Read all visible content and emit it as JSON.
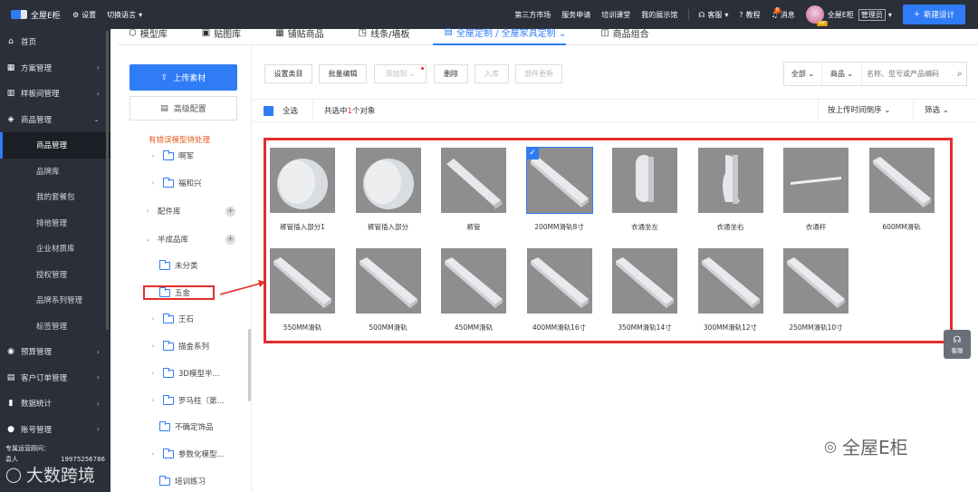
{
  "topbar": {
    "brand": "全屋E柜",
    "settings": "设置",
    "language": "切换语言",
    "links": [
      "第三方市场",
      "服务申请",
      "培训课堂",
      "我的展示馆"
    ],
    "service": "客服",
    "tutorial": "教程",
    "message": "消息",
    "message_count": "8",
    "vip": "VIP",
    "user": "全屋E柜",
    "role": "管理员",
    "new_design": "新建设计"
  },
  "nav": {
    "items": [
      {
        "label": "首页",
        "icon": "home-icon",
        "glyph": "⌂"
      },
      {
        "label": "方案管理",
        "icon": "grid-icon",
        "glyph": "▦",
        "arrow": "›"
      },
      {
        "label": "样板间管理",
        "icon": "room-icon",
        "glyph": "▥",
        "arrow": "›"
      },
      {
        "label": "商品管理",
        "icon": "box-icon",
        "glyph": "◈",
        "arrow": "⌄"
      }
    ],
    "subs": [
      "商品管理",
      "品牌库",
      "我的套餐包",
      "排他管理",
      "企业材质库",
      "授权管理",
      "品牌系列管理",
      "标签管理"
    ],
    "items2": [
      {
        "label": "预算管理",
        "icon": "budget-icon",
        "glyph": "◉",
        "arrow": "›"
      },
      {
        "label": "客户订单管理",
        "icon": "order-icon",
        "glyph": "▤",
        "arrow": "›"
      },
      {
        "label": "数据统计",
        "icon": "chart-icon",
        "glyph": "▮",
        "arrow": "›"
      },
      {
        "label": "账号管理",
        "icon": "account-icon",
        "glyph": "●",
        "arrow": "›"
      }
    ],
    "footer_title": "专属运营顾问：",
    "footer_name": "袁人",
    "footer_phone": "19975256786"
  },
  "tabs": [
    {
      "label": "模型库",
      "icon": "cube-icon",
      "glyph": "⬡"
    },
    {
      "label": "贴图库",
      "icon": "image-icon",
      "glyph": "▣"
    },
    {
      "label": "铺贴商品",
      "icon": "tile-icon",
      "glyph": "▦"
    },
    {
      "label": "线条/墙板",
      "icon": "line-icon",
      "glyph": "◳"
    },
    {
      "label": "全屋定制 / 全屋家具定制 ⌄",
      "icon": "custom-icon",
      "glyph": "▤"
    },
    {
      "label": "商品组合",
      "icon": "combo-icon",
      "glyph": "◫"
    }
  ],
  "category": {
    "upload": "上传素材",
    "advanced": "高级配置",
    "warning": "有错误模型待处理",
    "tree": [
      {
        "label": "啊军",
        "toggle": "›",
        "folder": true
      },
      {
        "label": "福和兴",
        "toggle": "›",
        "folder": true
      },
      {
        "label": "配件库",
        "toggle": "›",
        "folder": false,
        "plus": "+"
      },
      {
        "label": "半成品库",
        "toggle": "⌄",
        "folder": false,
        "plus": "+"
      },
      {
        "label": "未分类",
        "toggle": "",
        "folder": true
      },
      {
        "label": "五金",
        "toggle": "",
        "folder": true
      },
      {
        "label": "王石",
        "toggle": "›",
        "folder": true
      },
      {
        "label": "描金系列",
        "toggle": "›",
        "folder": true
      },
      {
        "label": "3D模型半...",
        "toggle": "›",
        "folder": true
      },
      {
        "label": "罗马柱（第...",
        "toggle": "›",
        "folder": true
      },
      {
        "label": "不确定饰品",
        "toggle": "",
        "folder": true
      },
      {
        "label": "参数化模型...",
        "toggle": "›",
        "folder": true
      },
      {
        "label": "培训练习",
        "toggle": "",
        "folder": true
      }
    ]
  },
  "toolbar": {
    "set_category": "设置类目",
    "batch_edit": "批量编辑",
    "add_to": "添加到 ⌄",
    "delete": "删除",
    "store": "入库",
    "part_update": "部件更新",
    "filter_all": "全部 ⌄",
    "filter_goods": "商品 ⌄",
    "search_placeholder": "名称、型号或产品编码"
  },
  "select_row": {
    "select_all": "全选",
    "count_prefix": "共选中",
    "count": "1",
    "count_suffix": "个对象",
    "sort": "按上传时间倒序 ⌄",
    "filter": "筛选 ⌄"
  },
  "products": [
    {
      "name": "裤管插入部分1",
      "shape": "cylinder"
    },
    {
      "name": "裤管插入部分",
      "shape": "cylinder"
    },
    {
      "name": "裤管",
      "shape": "rod"
    },
    {
      "name": "200MM滑轨8寸",
      "shape": "rail",
      "selected": true
    },
    {
      "name": "衣通坐左",
      "shape": "bracket"
    },
    {
      "name": "衣通坐右",
      "shape": "bracket2"
    },
    {
      "name": "衣通杆",
      "shape": "thin"
    },
    {
      "name": "600MM滑轨",
      "shape": "rail"
    },
    {
      "name": "550MM滑轨",
      "shape": "rail"
    },
    {
      "name": "500MM滑轨",
      "shape": "rail"
    },
    {
      "name": "450MM滑轨",
      "shape": "rail"
    },
    {
      "name": "400MM滑轨16寸",
      "shape": "rail"
    },
    {
      "name": "350MM滑轨14寸",
      "shape": "rail"
    },
    {
      "name": "300MM滑轨12寸",
      "shape": "rail"
    },
    {
      "name": "250MM滑轨10寸",
      "shape": "rail"
    }
  ],
  "float_service": "客服",
  "watermark": "全屋E柜",
  "watermark_left": "大数跨境",
  "colors": {
    "accent": "#2f7cf6",
    "highlight": "#e42d2d",
    "nav_bg": "#2b2f3a",
    "warning": "#e65a1e"
  }
}
